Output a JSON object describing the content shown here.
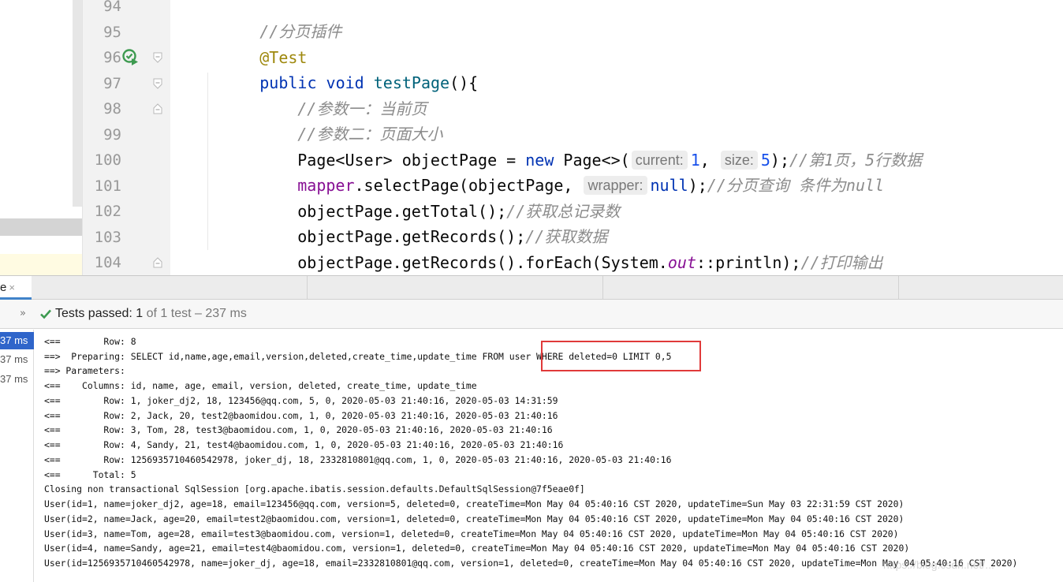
{
  "editor": {
    "lines": [
      {
        "num": "94"
      },
      {
        "num": "95"
      },
      {
        "num": "96"
      },
      {
        "num": "97"
      },
      {
        "num": "98"
      },
      {
        "num": "99"
      },
      {
        "num": "100"
      },
      {
        "num": "101"
      },
      {
        "num": "102"
      },
      {
        "num": "103"
      },
      {
        "num": "104"
      }
    ],
    "code": {
      "l94": "//分页插件",
      "l95": "@Test",
      "l96_kw1": "public",
      "l96_kw2": "void",
      "l96_name": "testPage",
      "l96_rest": "(){",
      "l97": "//参数一：当前页",
      "l98": "//参数二：页面大小",
      "l99_a": "Page<User> objectPage = ",
      "l99_new": "new",
      "l99_b": " Page<>(",
      "l99_hint1": "current:",
      "l99_v1": "1",
      "l99_c": ", ",
      "l99_hint2": "size:",
      "l99_v2": "5",
      "l99_d": ");",
      "l99_cm": "//第1页，5行数据",
      "l100_fld": "mapper",
      "l100_a": ".selectPage(objectPage, ",
      "l100_hint": "wrapper:",
      "l100_null": "null",
      "l100_b": ");",
      "l100_cm": "//分页查询 条件为null",
      "l101_a": "objectPage.getTotal();",
      "l101_cm": "//获取总记录数",
      "l102_a": "objectPage.getRecords();",
      "l102_cm": "//获取数据",
      "l103_a": "objectPage.getRecords().forEach(System.",
      "l103_out": "out",
      "l103_b": "::println);",
      "l103_cm": "//打印输出",
      "l104": "}"
    }
  },
  "run": {
    "tab_label": "e",
    "tab_close": "×",
    "status_prefix": "Tests passed: ",
    "status_count": "1",
    "status_tail": " of 1 test – 237 ms",
    "tree_times": [
      "37 ms",
      "37 ms",
      "37 ms"
    ]
  },
  "console": {
    "lines": [
      "<==        Row: 8",
      "==>  Preparing: SELECT id,name,age,email,version,deleted,create_time,update_time FROM user WHERE deleted=0 LIMIT 0,5",
      "==> Parameters: ",
      "<==    Columns: id, name, age, email, version, deleted, create_time, update_time",
      "<==        Row: 1, joker_dj2, 18, 123456@qq.com, 5, 0, 2020-05-03 21:40:16, 2020-05-03 14:31:59",
      "<==        Row: 2, Jack, 20, test2@baomidou.com, 1, 0, 2020-05-03 21:40:16, 2020-05-03 21:40:16",
      "<==        Row: 3, Tom, 28, test3@baomidou.com, 1, 0, 2020-05-03 21:40:16, 2020-05-03 21:40:16",
      "<==        Row: 4, Sandy, 21, test4@baomidou.com, 1, 0, 2020-05-03 21:40:16, 2020-05-03 21:40:16",
      "<==        Row: 1256935710460542978, joker_dj, 18, 2332810801@qq.com, 1, 0, 2020-05-03 21:40:16, 2020-05-03 21:40:16",
      "<==      Total: 5",
      "Closing non transactional SqlSession [org.apache.ibatis.session.defaults.DefaultSqlSession@7f5eae0f]",
      "User(id=1, name=joker_dj2, age=18, email=123456@qq.com, version=5, deleted=0, createTime=Mon May 04 05:40:16 CST 2020, updateTime=Sun May 03 22:31:59 CST 2020)",
      "User(id=2, name=Jack, age=20, email=test2@baomidou.com, version=1, deleted=0, createTime=Mon May 04 05:40:16 CST 2020, updateTime=Mon May 04 05:40:16 CST 2020)",
      "User(id=3, name=Tom, age=28, email=test3@baomidou.com, version=1, deleted=0, createTime=Mon May 04 05:40:16 CST 2020, updateTime=Mon May 04 05:40:16 CST 2020)",
      "User(id=4, name=Sandy, age=21, email=test4@baomidou.com, version=1, deleted=0, createTime=Mon May 04 05:40:16 CST 2020, updateTime=Mon May 04 05:40:16 CST 2020)",
      "User(id=1256935710460542978, name=joker_dj, age=18, email=2332810801@qq.com, version=1, deleted=0, createTime=Mon May 04 05:40:16 CST 2020, updateTime=Mon May 04 05:40:16 CST 2020)"
    ],
    "watermark": "https://blog.csdn.net/..."
  },
  "colors": {
    "keyword": "#0033b3",
    "annotation": "#9e880d",
    "comment": "#8c8c8c",
    "field": "#871094",
    "number": "#1750eb",
    "highlight_box": "#e03a3a",
    "selected_tree": "#2f65ca",
    "pass_check": "#3d9a50"
  },
  "icons": {
    "run_gutter": "run-test-passed-icon",
    "fold": "fold-marker-icon",
    "status_check": "check-icon",
    "expand": "expand-arrows-icon"
  }
}
